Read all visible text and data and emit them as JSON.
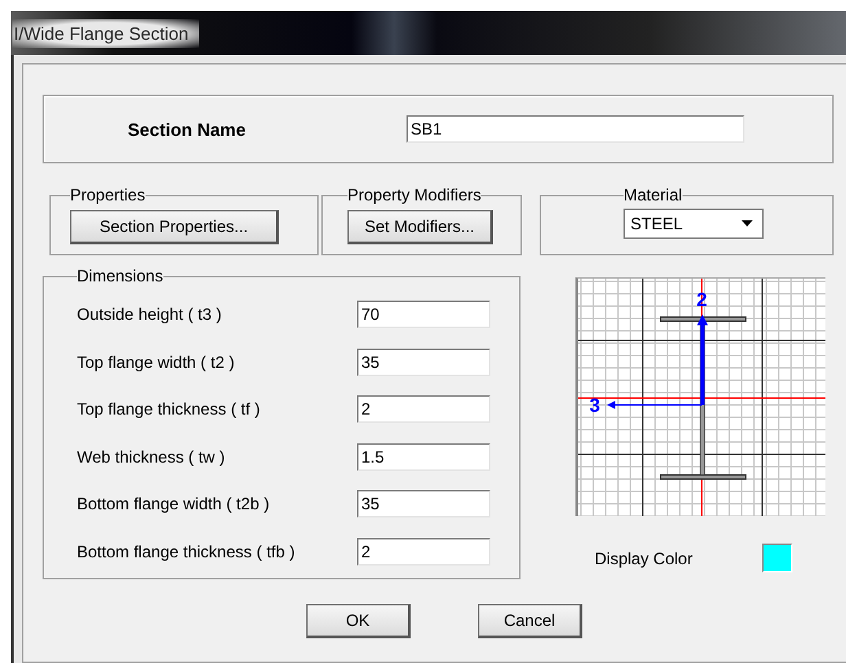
{
  "window": {
    "title": "I/Wide Flange Section"
  },
  "section_name": {
    "label": "Section Name",
    "value": "SB1"
  },
  "properties": {
    "label": "Properties",
    "button": "Section Properties..."
  },
  "property_modifiers": {
    "label": "Property Modifiers",
    "button": "Set Modifiers..."
  },
  "material": {
    "label": "Material",
    "value": "STEEL"
  },
  "dimensions": {
    "label": "Dimensions",
    "rows": [
      {
        "label": "Outside height  ( t3 )",
        "value": "70"
      },
      {
        "label": "Top flange width  ( t2 )",
        "value": "35"
      },
      {
        "label": "Top flange thickness  ( tf )",
        "value": "2"
      },
      {
        "label": "Web thickness  ( tw )",
        "value": "1.5"
      },
      {
        "label": "Bottom flange width  ( t2b )",
        "value": "35"
      },
      {
        "label": "Bottom flange thickness  ( tfb )",
        "value": "2"
      }
    ]
  },
  "section_diagram": {
    "axis_2_label": "2",
    "axis_3_label": "3"
  },
  "display_color": {
    "label": "Display Color",
    "color": "#00ffff"
  },
  "buttons": [
    "OK",
    "Cancel"
  ]
}
